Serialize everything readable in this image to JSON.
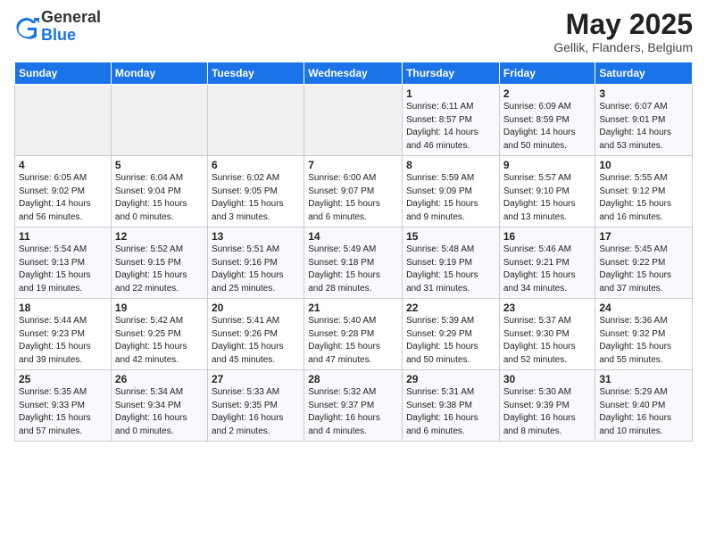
{
  "logo": {
    "general": "General",
    "blue": "Blue"
  },
  "header": {
    "month": "May 2025",
    "location": "Gellik, Flanders, Belgium"
  },
  "weekdays": [
    "Sunday",
    "Monday",
    "Tuesday",
    "Wednesday",
    "Thursday",
    "Friday",
    "Saturday"
  ],
  "weeks": [
    [
      {
        "day": "",
        "info": ""
      },
      {
        "day": "",
        "info": ""
      },
      {
        "day": "",
        "info": ""
      },
      {
        "day": "",
        "info": ""
      },
      {
        "day": "1",
        "info": "Sunrise: 6:11 AM\nSunset: 8:57 PM\nDaylight: 14 hours\nand 46 minutes."
      },
      {
        "day": "2",
        "info": "Sunrise: 6:09 AM\nSunset: 8:59 PM\nDaylight: 14 hours\nand 50 minutes."
      },
      {
        "day": "3",
        "info": "Sunrise: 6:07 AM\nSunset: 9:01 PM\nDaylight: 14 hours\nand 53 minutes."
      }
    ],
    [
      {
        "day": "4",
        "info": "Sunrise: 6:05 AM\nSunset: 9:02 PM\nDaylight: 14 hours\nand 56 minutes."
      },
      {
        "day": "5",
        "info": "Sunrise: 6:04 AM\nSunset: 9:04 PM\nDaylight: 15 hours\nand 0 minutes."
      },
      {
        "day": "6",
        "info": "Sunrise: 6:02 AM\nSunset: 9:05 PM\nDaylight: 15 hours\nand 3 minutes."
      },
      {
        "day": "7",
        "info": "Sunrise: 6:00 AM\nSunset: 9:07 PM\nDaylight: 15 hours\nand 6 minutes."
      },
      {
        "day": "8",
        "info": "Sunrise: 5:59 AM\nSunset: 9:09 PM\nDaylight: 15 hours\nand 9 minutes."
      },
      {
        "day": "9",
        "info": "Sunrise: 5:57 AM\nSunset: 9:10 PM\nDaylight: 15 hours\nand 13 minutes."
      },
      {
        "day": "10",
        "info": "Sunrise: 5:55 AM\nSunset: 9:12 PM\nDaylight: 15 hours\nand 16 minutes."
      }
    ],
    [
      {
        "day": "11",
        "info": "Sunrise: 5:54 AM\nSunset: 9:13 PM\nDaylight: 15 hours\nand 19 minutes."
      },
      {
        "day": "12",
        "info": "Sunrise: 5:52 AM\nSunset: 9:15 PM\nDaylight: 15 hours\nand 22 minutes."
      },
      {
        "day": "13",
        "info": "Sunrise: 5:51 AM\nSunset: 9:16 PM\nDaylight: 15 hours\nand 25 minutes."
      },
      {
        "day": "14",
        "info": "Sunrise: 5:49 AM\nSunset: 9:18 PM\nDaylight: 15 hours\nand 28 minutes."
      },
      {
        "day": "15",
        "info": "Sunrise: 5:48 AM\nSunset: 9:19 PM\nDaylight: 15 hours\nand 31 minutes."
      },
      {
        "day": "16",
        "info": "Sunrise: 5:46 AM\nSunset: 9:21 PM\nDaylight: 15 hours\nand 34 minutes."
      },
      {
        "day": "17",
        "info": "Sunrise: 5:45 AM\nSunset: 9:22 PM\nDaylight: 15 hours\nand 37 minutes."
      }
    ],
    [
      {
        "day": "18",
        "info": "Sunrise: 5:44 AM\nSunset: 9:23 PM\nDaylight: 15 hours\nand 39 minutes."
      },
      {
        "day": "19",
        "info": "Sunrise: 5:42 AM\nSunset: 9:25 PM\nDaylight: 15 hours\nand 42 minutes."
      },
      {
        "day": "20",
        "info": "Sunrise: 5:41 AM\nSunset: 9:26 PM\nDaylight: 15 hours\nand 45 minutes."
      },
      {
        "day": "21",
        "info": "Sunrise: 5:40 AM\nSunset: 9:28 PM\nDaylight: 15 hours\nand 47 minutes."
      },
      {
        "day": "22",
        "info": "Sunrise: 5:39 AM\nSunset: 9:29 PM\nDaylight: 15 hours\nand 50 minutes."
      },
      {
        "day": "23",
        "info": "Sunrise: 5:37 AM\nSunset: 9:30 PM\nDaylight: 15 hours\nand 52 minutes."
      },
      {
        "day": "24",
        "info": "Sunrise: 5:36 AM\nSunset: 9:32 PM\nDaylight: 15 hours\nand 55 minutes."
      }
    ],
    [
      {
        "day": "25",
        "info": "Sunrise: 5:35 AM\nSunset: 9:33 PM\nDaylight: 15 hours\nand 57 minutes."
      },
      {
        "day": "26",
        "info": "Sunrise: 5:34 AM\nSunset: 9:34 PM\nDaylight: 16 hours\nand 0 minutes."
      },
      {
        "day": "27",
        "info": "Sunrise: 5:33 AM\nSunset: 9:35 PM\nDaylight: 16 hours\nand 2 minutes."
      },
      {
        "day": "28",
        "info": "Sunrise: 5:32 AM\nSunset: 9:37 PM\nDaylight: 16 hours\nand 4 minutes."
      },
      {
        "day": "29",
        "info": "Sunrise: 5:31 AM\nSunset: 9:38 PM\nDaylight: 16 hours\nand 6 minutes."
      },
      {
        "day": "30",
        "info": "Sunrise: 5:30 AM\nSunset: 9:39 PM\nDaylight: 16 hours\nand 8 minutes."
      },
      {
        "day": "31",
        "info": "Sunrise: 5:29 AM\nSunset: 9:40 PM\nDaylight: 16 hours\nand 10 minutes."
      }
    ]
  ]
}
